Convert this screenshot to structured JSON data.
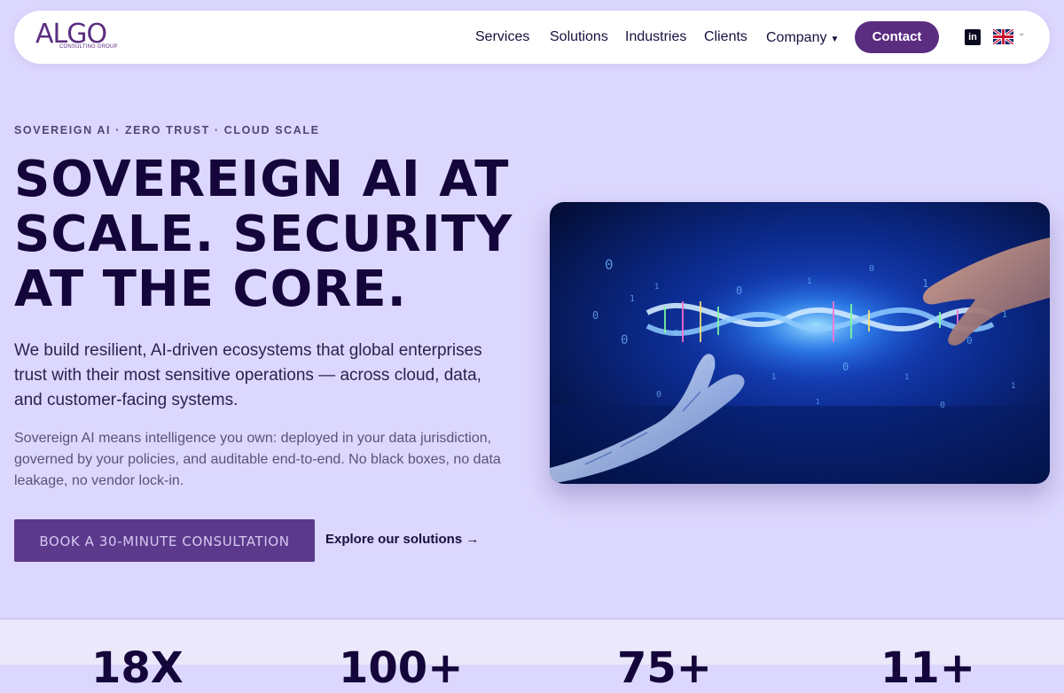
{
  "brand": {
    "name": "ALGO",
    "tagline": "CONSULTING GROUP"
  },
  "nav": {
    "links": [
      "Services",
      "Solutions",
      "Industries",
      "Clients",
      "Company"
    ],
    "contact_label": "Contact",
    "language": "English (UK) flag"
  },
  "hero": {
    "eyebrow": "SOVEREIGN AI · ZERO TRUST · CLOUD SCALE",
    "title_lines": [
      "SOVEREIGN AI AT",
      "SCALE. SECURITY",
      "AT THE CORE."
    ],
    "lead": "We build resilient, AI-driven ecosystems that global enterprises trust with their most sensitive operations — across cloud, data, and customer-facing systems.",
    "sublead": "Sovereign AI means intelligence you own: deployed in your data jurisdiction, governed by your policies, and auditable end-to-end. No black boxes, no data leakage, no vendor lock-in.",
    "cta_label": "BOOK A 30-MINUTE CONSULTATION",
    "explore_label": "Explore our solutions →"
  },
  "stats": [
    "18X",
    "100+",
    "75+",
    "11+"
  ],
  "colors": {
    "background": "#dcd7fe",
    "accent": "#5b2d80",
    "heading": "#14063a"
  }
}
